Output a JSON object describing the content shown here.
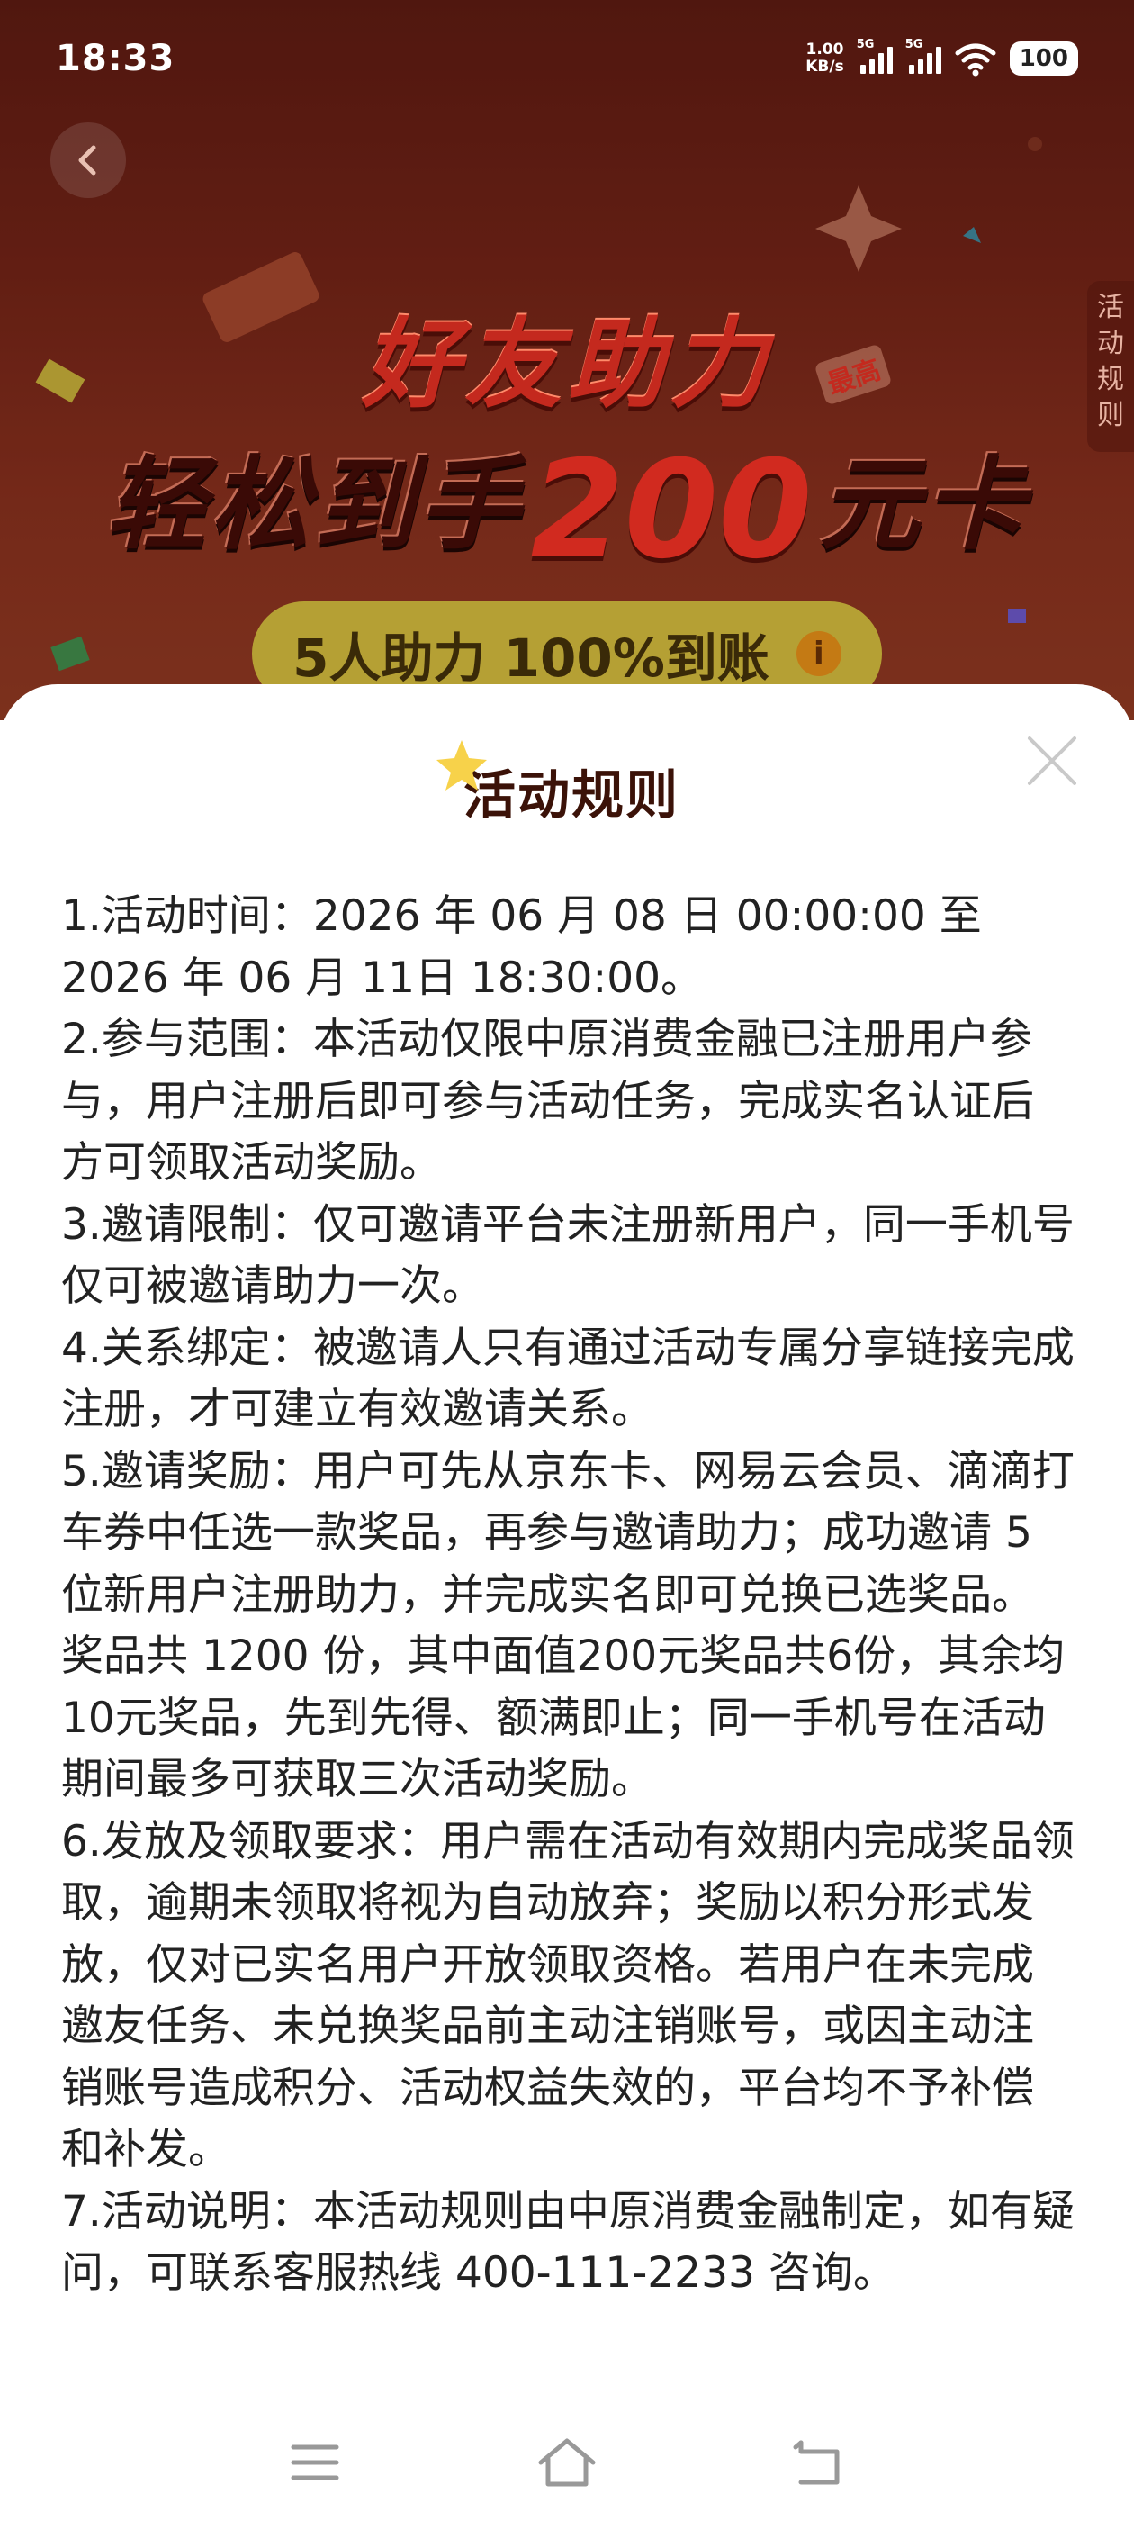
{
  "status_bar": {
    "time": "18:33",
    "net_speed_value": "1.00",
    "net_speed_unit": "KB/s",
    "sim1_label": "5G",
    "sim2_label": "5G",
    "battery": "100"
  },
  "banner": {
    "rules_tab_label": "活动规则",
    "title_line1": "好友助力",
    "title_line2_prefix": "轻松到手",
    "title_amount": "200",
    "title_line2_suffix": "元卡",
    "max_badge": "最高",
    "pill_text": "5人助力 100%到账",
    "pill_info": "i"
  },
  "modal": {
    "title": "活动规则",
    "rules": [
      "1.活动时间：2026 年 06 月 08 日 00:00:00 至 2026 年 06 月 11日 18:30:00。",
      "2.参与范围：本活动仅限中原消费金融已注册用户参与，用户注册后即可参与活动任务，完成实名认证后方可领取活动奖励。",
      "3.邀请限制：仅可邀请平台未注册新用户，同一手机号仅可被邀请助力一次。",
      "4.关系绑定：被邀请人只有通过活动专属分享链接完成注册，才可建立有效邀请关系。",
      "5.邀请奖励：用户可先从京东卡、网易云会员、滴滴打车券中任选一款奖品，再参与邀请助力；成功邀请 5 位新用户注册助力，并完成实名即可兑换已选奖品。奖品共 1200 份，其中面值200元奖品共6份，其余均10元奖品，先到先得、额满即止；同一手机号在活动期间最多可获取三次活动奖励。",
      "6.发放及领取要求：用户需在活动有效期内完成奖品领取，逾期未领取将视为自动放弃；奖励以积分形式发放，仅对已实名用户开放领取资格。若用户在未完成邀友任务、未兑换奖品前主动注销账号，或因主动注销账号造成积分、活动权益失效的，平台均不予补偿和补发。",
      "7.活动说明：本活动规则由中原消费金融制定，如有疑问，可联系客服热线 400-111-2233 咨询。"
    ]
  },
  "colors": {
    "banner_bg": "#6e2216",
    "title_red": "#c4291e",
    "title_underline": "#c7ef5f",
    "pill_bg": "#b5a034",
    "text": "#222222"
  },
  "icons": {
    "back": "chevron-left-icon",
    "close": "close-icon",
    "nav_menu": "menu-icon",
    "nav_home": "home-icon",
    "nav_back": "back-icon"
  }
}
